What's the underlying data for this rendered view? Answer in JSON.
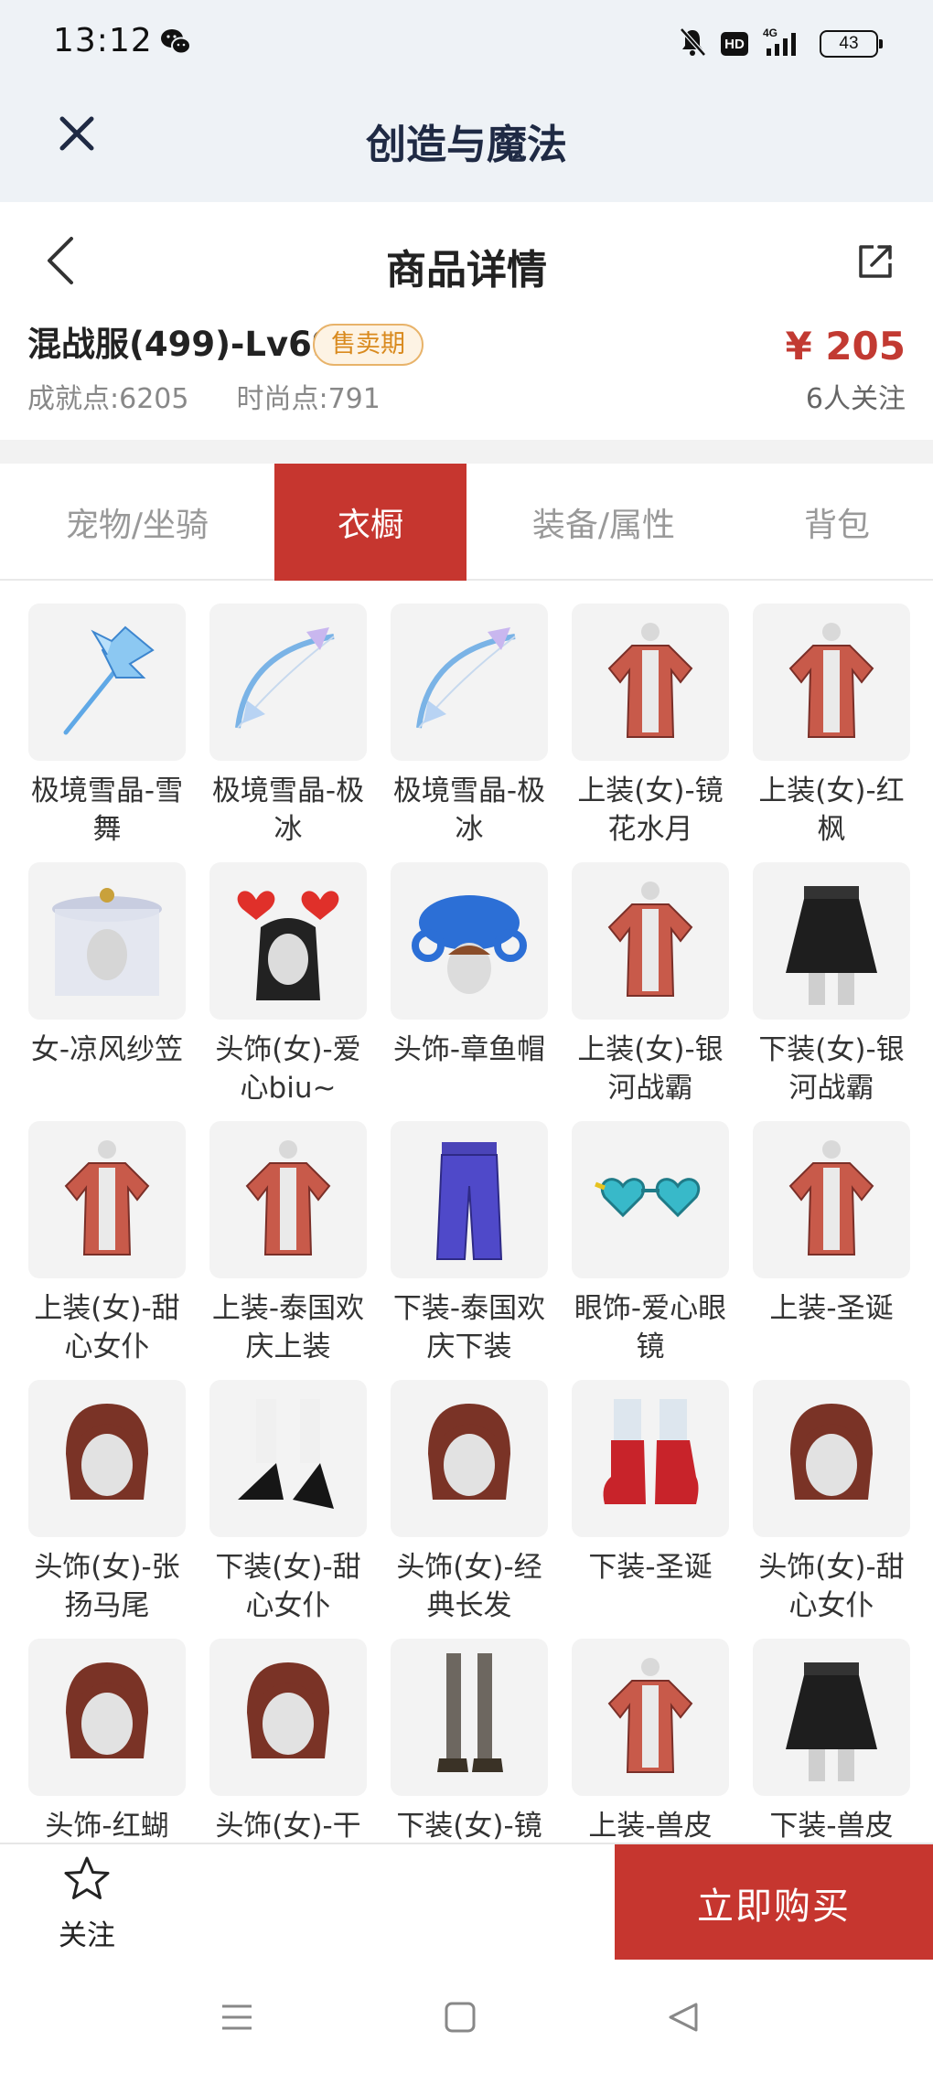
{
  "status_bar": {
    "time": "13:12",
    "hd": "HD",
    "network": "4G",
    "battery": "43"
  },
  "app": {
    "title": "创造与魔法"
  },
  "nav": {
    "title": "商品详情"
  },
  "product": {
    "name": "混战服(499)-Lv69",
    "badge": "售卖期",
    "achievement_label": "成就点:",
    "achievement_value": "6205",
    "fashion_label": "时尚点:",
    "fashion_value": "791",
    "price": "¥ 205",
    "followers": "6人关注"
  },
  "tabs": [
    {
      "label": "宠物/坐骑",
      "active": false
    },
    {
      "label": "衣橱",
      "active": true
    },
    {
      "label": "装备/属性",
      "active": false
    },
    {
      "label": "背包",
      "active": false
    }
  ],
  "items": [
    {
      "label": "极境雪晶-雪舞",
      "icon": "ice-scythe-icon"
    },
    {
      "label": "极境雪晶-极冰",
      "icon": "ice-bow-icon"
    },
    {
      "label": "极境雪晶-极冰",
      "icon": "ice-bow-icon"
    },
    {
      "label": "上装(女)-镜花水月",
      "icon": "top-garment-icon"
    },
    {
      "label": "上装(女)-红枫",
      "icon": "top-garment-icon"
    },
    {
      "label": "女-凉风纱笠",
      "icon": "veil-hat-icon"
    },
    {
      "label": "头饰(女)-爱心biu~",
      "icon": "heart-headband-icon"
    },
    {
      "label": "头饰-章鱼帽",
      "icon": "octopus-hat-icon"
    },
    {
      "label": "上装(女)-银河战霸",
      "icon": "top-garment-icon"
    },
    {
      "label": "下装(女)-银河战霸",
      "icon": "skirt-icon"
    },
    {
      "label": "上装(女)-甜心女仆",
      "icon": "top-garment-icon"
    },
    {
      "label": "上装-泰国欢庆上装",
      "icon": "top-garment-icon"
    },
    {
      "label": "下装-泰国欢庆下装",
      "icon": "pants-icon"
    },
    {
      "label": "眼饰-爱心眼镜",
      "icon": "heart-glasses-icon"
    },
    {
      "label": "上装-圣诞",
      "icon": "top-garment-icon"
    },
    {
      "label": "头饰(女)-张扬马尾",
      "icon": "hairstyle-icon"
    },
    {
      "label": "下装(女)-甜心女仆",
      "icon": "shoes-icon"
    },
    {
      "label": "头饰(女)-经典长发",
      "icon": "hairstyle-icon"
    },
    {
      "label": "下装-圣诞",
      "icon": "boots-icon"
    },
    {
      "label": "头饰(女)-甜心女仆",
      "icon": "hairstyle-icon"
    },
    {
      "label": "头饰-红蝴",
      "icon": "hairstyle-icon"
    },
    {
      "label": "头饰(女)-干",
      "icon": "hairstyle-icon"
    },
    {
      "label": "下装(女)-镜",
      "icon": "legs-icon"
    },
    {
      "label": "上装-兽皮",
      "icon": "top-garment-icon"
    },
    {
      "label": "下装-兽皮",
      "icon": "skirt-icon"
    }
  ],
  "bottom": {
    "follow_label": "关注",
    "buy_label": "立即购买"
  },
  "colors": {
    "accent": "#c6362f",
    "price": "#c23a32",
    "badge_text": "#d98a1e",
    "badge_border": "#e8b36a",
    "top_bg": "#eef2f6"
  }
}
